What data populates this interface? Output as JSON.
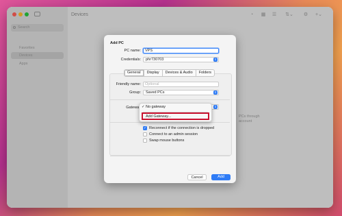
{
  "sidebar": {
    "search_placeholder": "Search",
    "items": [
      {
        "label": "Favorites"
      },
      {
        "label": "Devices"
      },
      {
        "label": "Apps"
      }
    ]
  },
  "main": {
    "title": "Devices",
    "background_hint_line1": "PCs through",
    "background_hint_line2": "account"
  },
  "dialog": {
    "title": "Add PC",
    "pc_name_label": "PC name:",
    "pc_name_value": "VPS",
    "credentials_label": "Credentials:",
    "credentials_value": "phr730703",
    "tabs": [
      "General",
      "Display",
      "Devices & Audio",
      "Folders"
    ],
    "active_tab": "General",
    "friendly_name_label": "Friendly name:",
    "friendly_name_placeholder": "Optional",
    "group_label": "Group:",
    "group_value": "Saved PCs",
    "gateway_label": "Gateway",
    "checkboxes": [
      {
        "label": "Reconnect if the connection is dropped",
        "checked": true
      },
      {
        "label": "Connect to an admin session",
        "checked": false
      },
      {
        "label": "Swap mouse buttons",
        "checked": false
      }
    ],
    "cancel_label": "Cancel",
    "add_label": "Add"
  },
  "gateway_menu": {
    "items": [
      {
        "label": "No gateway",
        "checked": true
      },
      {
        "label": "Add Gateway...",
        "checked": false
      }
    ]
  },
  "colors": {
    "accent": "#2f7cf6",
    "highlight_box": "#c8102e"
  }
}
